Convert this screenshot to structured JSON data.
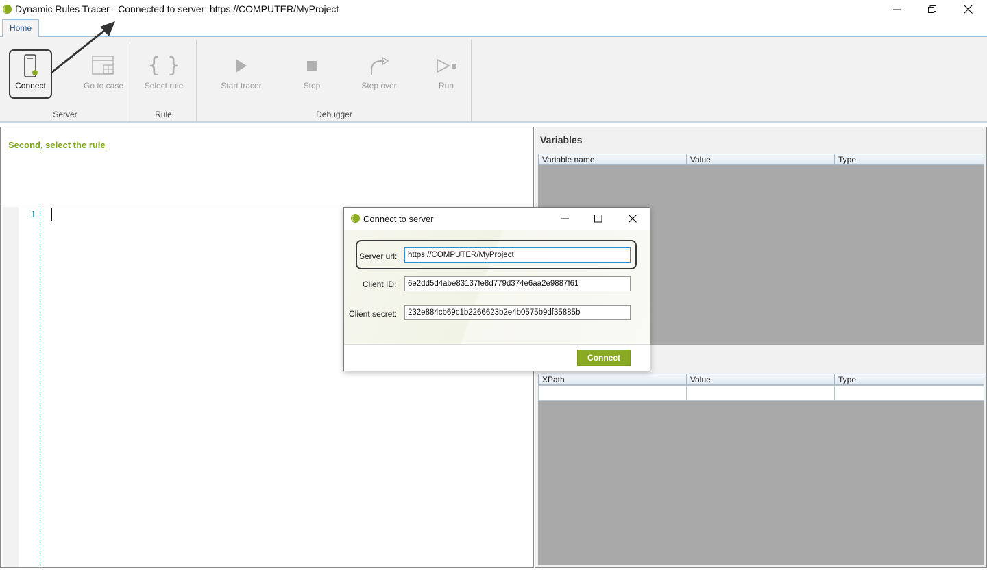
{
  "window": {
    "title": "Dynamic Rules Tracer - Connected to server: https://COMPUTER/MyProject",
    "minimize_icon": "minimize-icon",
    "restore_icon": "restore-icon",
    "close_icon": "close-icon"
  },
  "tabs": [
    {
      "label": "Home",
      "selected": true
    }
  ],
  "ribbon": {
    "groups": {
      "server": "Server",
      "rule": "Rule",
      "debugger": "Debugger"
    },
    "buttons": {
      "connect": "Connect",
      "go_to_case": "Go to case",
      "select_rule": "Select rule",
      "start_tracer": "Start tracer",
      "stop": "Stop",
      "step_over": "Step over",
      "run": "Run"
    }
  },
  "editor": {
    "hint_link": "Second, select the rule",
    "line_number": "1"
  },
  "variables": {
    "title": "Variables",
    "columns": [
      "Variable name",
      "Value",
      "Type"
    ]
  },
  "xpath": {
    "columns": [
      "XPath",
      "Value",
      "Type"
    ]
  },
  "dialog": {
    "title": "Connect to server",
    "server_url_label": "Server url:",
    "server_url_value": "https://COMPUTER/MyProject",
    "client_id_label": "Client ID:",
    "client_id_value": "6e2dd5d4abe83137fe8d779d374e6aa2e9887f61",
    "client_secret_label": "Client secret:",
    "client_secret_value": "232e884cb69c1b2266623b2e4b0575b9df35885b",
    "connect_button": "Connect"
  },
  "colors": {
    "accent_green": "#8aaa23",
    "link_green": "#7ea51a",
    "grid_gray": "#a9a9a9"
  }
}
